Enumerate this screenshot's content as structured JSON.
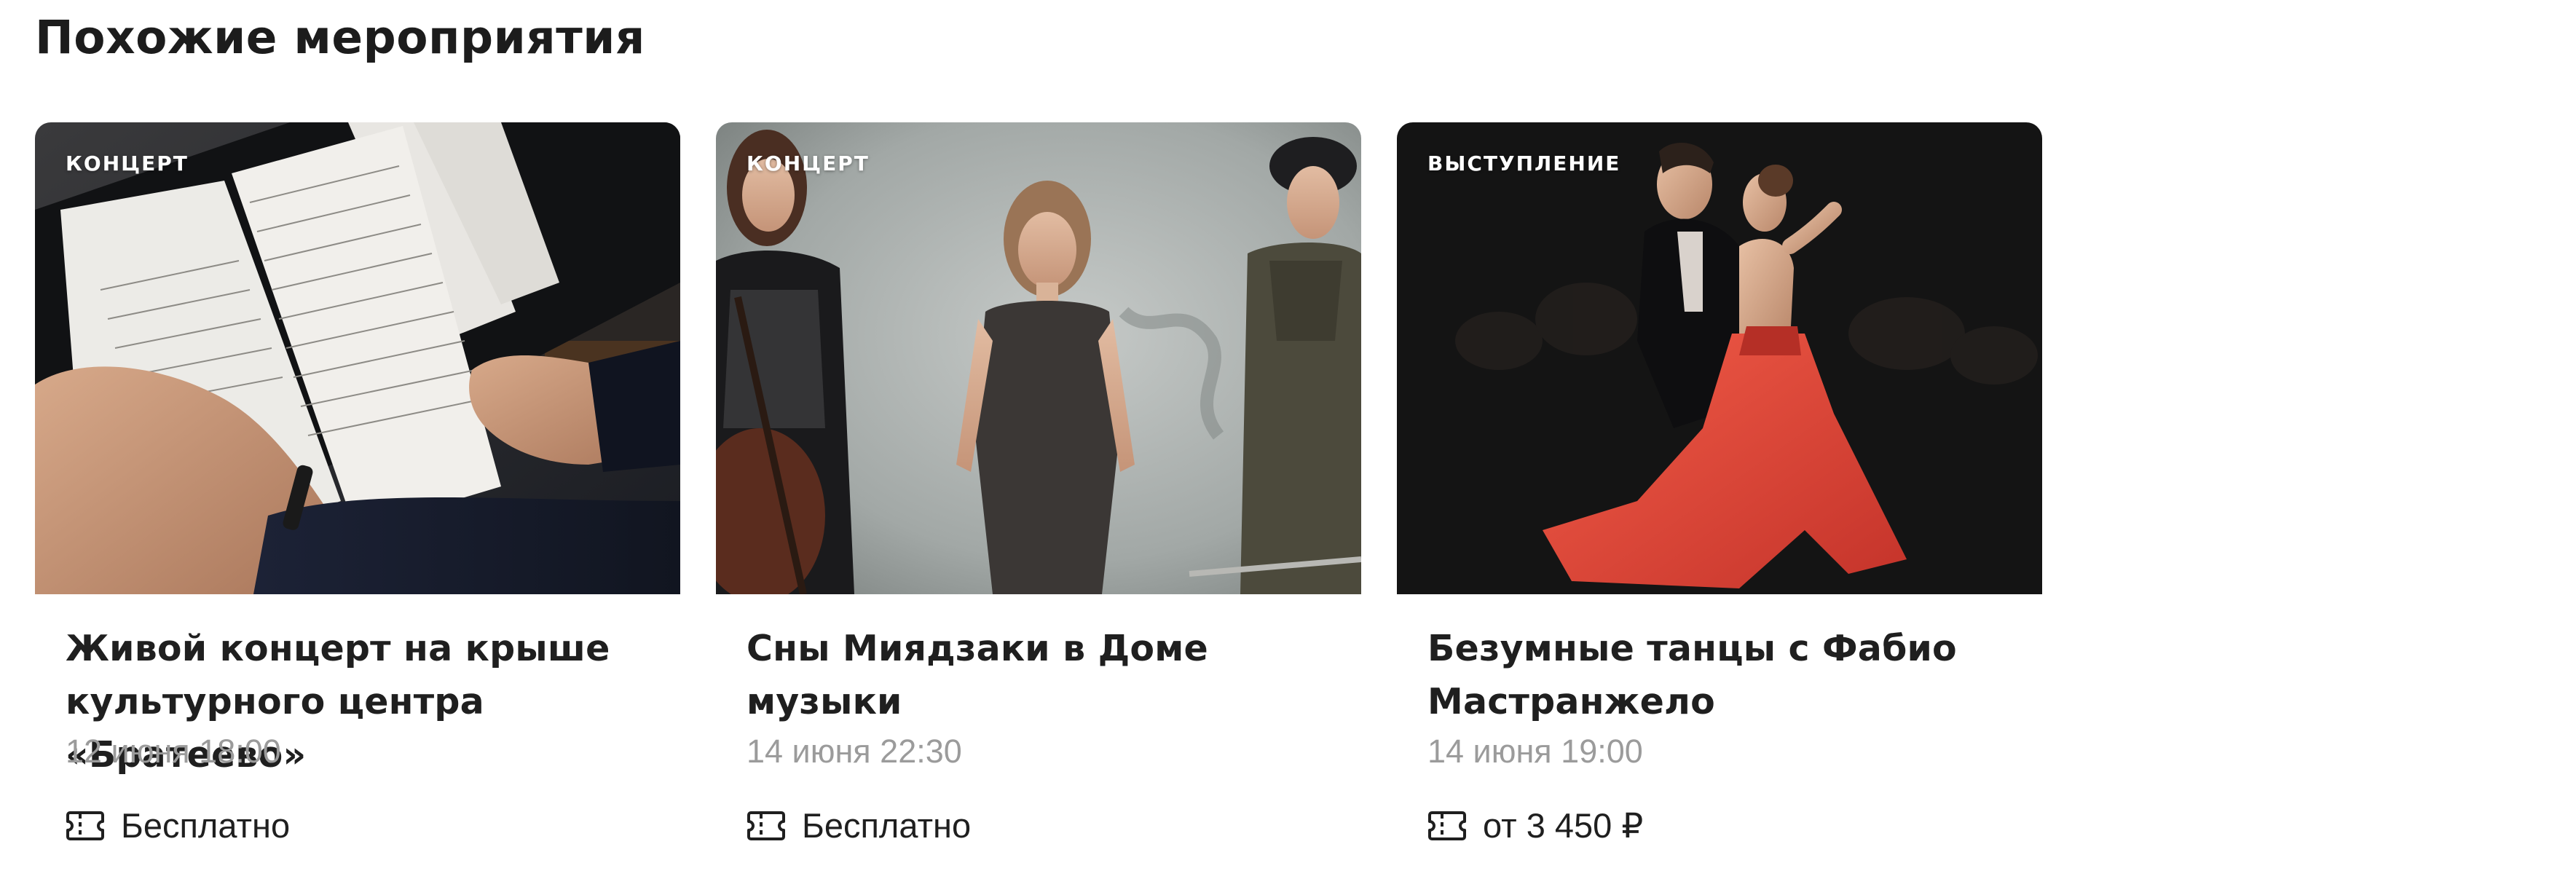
{
  "section": {
    "title": "Похожие мероприятия"
  },
  "cards": [
    {
      "category": "КОНЦЕРТ",
      "title": "Живой концерт на крыше культурного центра «Братеево»",
      "date": "12 июня 18:00",
      "price": "Бесплатно",
      "image_subject": "sheet-music-photo"
    },
    {
      "category": "КОНЦЕРТ",
      "title": "Сны Миядзаки в Доме музыки",
      "date": "14 июня 22:30",
      "price": "Бесплатно",
      "image_subject": "three-musicians-photo"
    },
    {
      "category": "ВЫСТУПЛЕНИЕ",
      "title": "Безумные танцы с Фабио Мастранжело",
      "date": "14 июня 19:00",
      "price": "от 3 450 ₽",
      "image_subject": "tango-dancers-photo"
    }
  ],
  "icons": {
    "price": "ticket-icon"
  },
  "colors": {
    "text_primary": "#1f1f1f",
    "text_secondary": "#9b9b9b",
    "badge_text": "#ffffff",
    "dress_red": "#e5493a"
  }
}
